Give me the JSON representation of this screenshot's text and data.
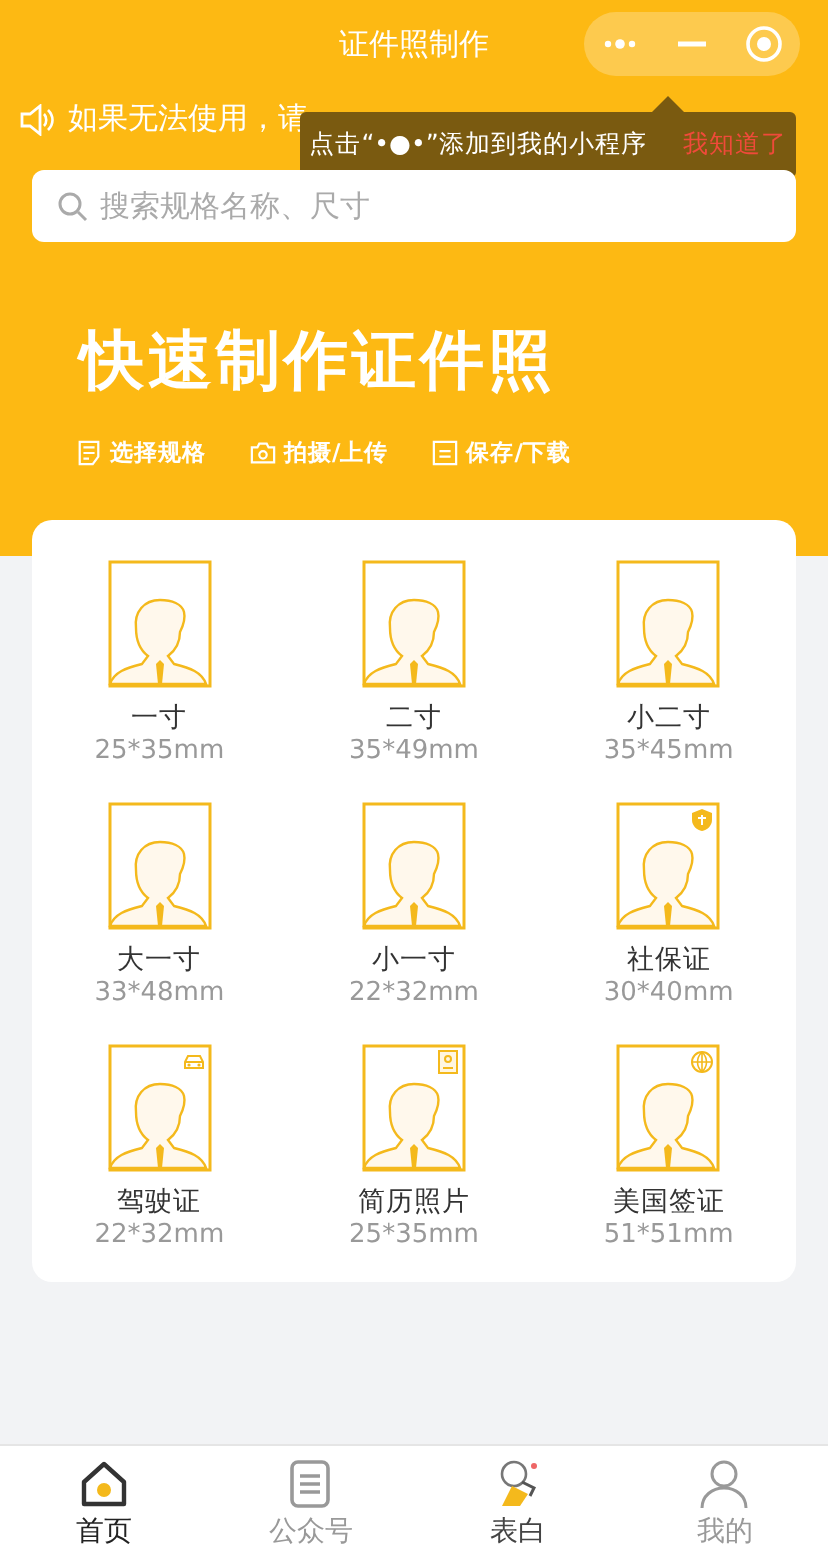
{
  "window": {
    "title": "证件照制作"
  },
  "notice": {
    "text": "如果无法使用，请"
  },
  "tip": {
    "text": "点击“•●•”添加到我的小程序",
    "action": "我知道了"
  },
  "search": {
    "placeholder": "搜索规格名称、尺寸"
  },
  "hero": {
    "title": "快速制作证件照",
    "steps": [
      {
        "kind": "list",
        "label": "选择规格"
      },
      {
        "kind": "camera",
        "label": "拍摄/上传"
      },
      {
        "kind": "save",
        "label": "保存/下载"
      }
    ]
  },
  "photos": [
    {
      "name": "一寸",
      "size": "25*35mm",
      "kind": "plain"
    },
    {
      "name": "二寸",
      "size": "35*49mm",
      "kind": "plain"
    },
    {
      "name": "小二寸",
      "size": "35*45mm",
      "kind": "plain"
    },
    {
      "name": "大一寸",
      "size": "33*48mm",
      "kind": "plain"
    },
    {
      "name": "小一寸",
      "size": "22*32mm",
      "kind": "plain"
    },
    {
      "name": "社保证",
      "size": "30*40mm",
      "kind": "shield"
    },
    {
      "name": "驾驶证",
      "size": "22*32mm",
      "kind": "car"
    },
    {
      "name": "简历照片",
      "size": "25*35mm",
      "kind": "card"
    },
    {
      "name": "美国签证",
      "size": "51*51mm",
      "kind": "globe"
    }
  ],
  "tabs": [
    {
      "label": "首页",
      "kind": "home",
      "selected": true
    },
    {
      "label": "公众号",
      "kind": "article",
      "selected": false
    },
    {
      "label": "表白",
      "kind": "heart",
      "selected": false
    },
    {
      "label": "我的",
      "kind": "person",
      "selected": false
    }
  ]
}
